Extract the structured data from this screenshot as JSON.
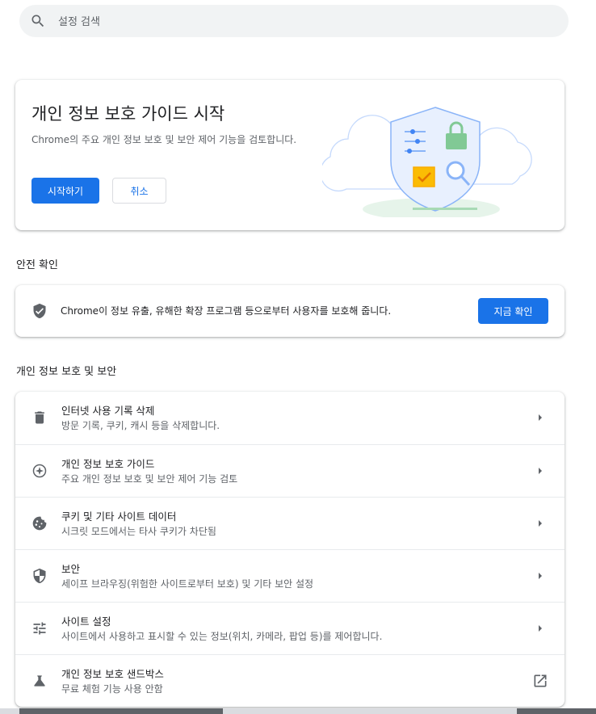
{
  "search": {
    "placeholder": "설정 검색",
    "icon": "search-icon"
  },
  "promo": {
    "title": "개인 정보 보호 가이드 시작",
    "description": "Chrome의 주요 개인 정보 보호 및 보안 제어 기능을 검토합니다.",
    "start_label": "시작하기",
    "cancel_label": "취소",
    "accent": "#1a73e8"
  },
  "safety_check": {
    "heading": "안전 확인",
    "text": "Chrome이 정보 유출, 유해한 확장 프로그램 등으로부터 사용자를 보호해 줍니다.",
    "button_label": "지금 확인",
    "icon": "shield-icon"
  },
  "privacy": {
    "heading": "개인 정보 보호 및 보안",
    "items": [
      {
        "label": "인터넷 사용 기록 삭제",
        "sub": "방문 기록, 쿠키, 캐시 등을 삭제합니다.",
        "icon": "trash-icon",
        "action": "arrow"
      },
      {
        "label": "개인 정보 보호 가이드",
        "sub": "주요 개인 정보 보호 및 보안 제어 기능 검토",
        "icon": "compass-icon",
        "action": "arrow"
      },
      {
        "label": "쿠키 및 기타 사이트 데이터",
        "sub": "시크릿 모드에서는 타사 쿠키가 차단됨",
        "icon": "cookie-icon",
        "action": "arrow"
      },
      {
        "label": "보안",
        "sub": "세이프 브라우징(위험한 사이트로부터 보호) 및 기타 보안 설정",
        "icon": "security-shield-icon",
        "action": "arrow"
      },
      {
        "label": "사이트 설정",
        "sub": "사이트에서 사용하고 표시할 수 있는 정보(위치, 카메라, 팝업 등)를 제어합니다.",
        "icon": "tune-icon",
        "action": "arrow"
      },
      {
        "label": "개인 정보 보호 샌드박스",
        "sub": "무료 체험 기능 사용 안함",
        "icon": "flask-icon",
        "action": "external"
      }
    ]
  }
}
